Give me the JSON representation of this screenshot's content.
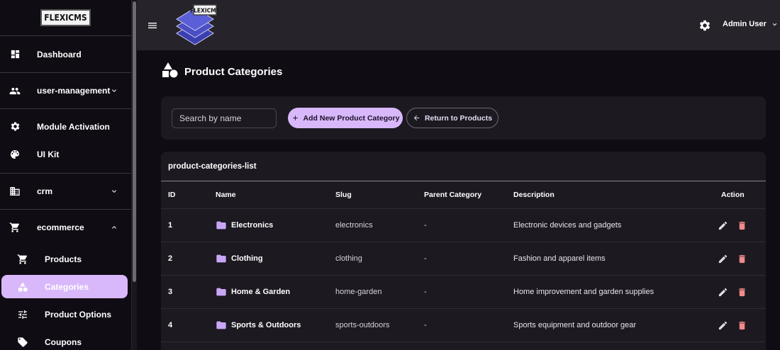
{
  "sidebar": {
    "logo_text": "FLEXICMS",
    "items": [
      {
        "label": "Dashboard",
        "icon": "dashboard-icon"
      },
      {
        "label": "user-management",
        "icon": "people-icon"
      },
      {
        "label": "Module Activation",
        "icon": "gear-icon"
      },
      {
        "label": "UI Kit",
        "icon": "palette-icon"
      },
      {
        "label": "crm",
        "icon": "building-icon"
      },
      {
        "label": "ecommerce",
        "icon": "cart-icon"
      }
    ],
    "sub_items": [
      {
        "label": "Products",
        "icon": "cart-icon"
      },
      {
        "label": "Categories",
        "icon": "shapes-icon"
      },
      {
        "label": "Product Options",
        "icon": "tune-icon"
      },
      {
        "label": "Coupons",
        "icon": "tag-icon"
      }
    ]
  },
  "topbar": {
    "logo_text": "FLEXICMS",
    "user_name": "Admin User"
  },
  "page": {
    "title": "Product Categories"
  },
  "toolbar": {
    "search_placeholder": "Search by name",
    "add_label": "Add New Product Category",
    "return_label": "Return to Products"
  },
  "table": {
    "title": "product-categories-list",
    "columns": [
      "ID",
      "Name",
      "Slug",
      "Parent Category",
      "Description",
      "Action"
    ],
    "rows": [
      {
        "id": "1",
        "name": "Electronics",
        "slug": "electronics",
        "parent": "-",
        "description": "Electronic devices and gadgets"
      },
      {
        "id": "2",
        "name": "Clothing",
        "slug": "clothing",
        "parent": "-",
        "description": "Fashion and apparel items"
      },
      {
        "id": "3",
        "name": "Home & Garden",
        "slug": "home-garden",
        "parent": "-",
        "description": "Home improvement and garden supplies"
      },
      {
        "id": "4",
        "name": "Sports & Outdoors",
        "slug": "sports-outdoors",
        "parent": "-",
        "description": "Sports equipment and outdoor gear"
      }
    ]
  },
  "colors": {
    "accent": "#d8b8fb",
    "delete": "#f08a8a",
    "folder": "#c9a6f5"
  }
}
